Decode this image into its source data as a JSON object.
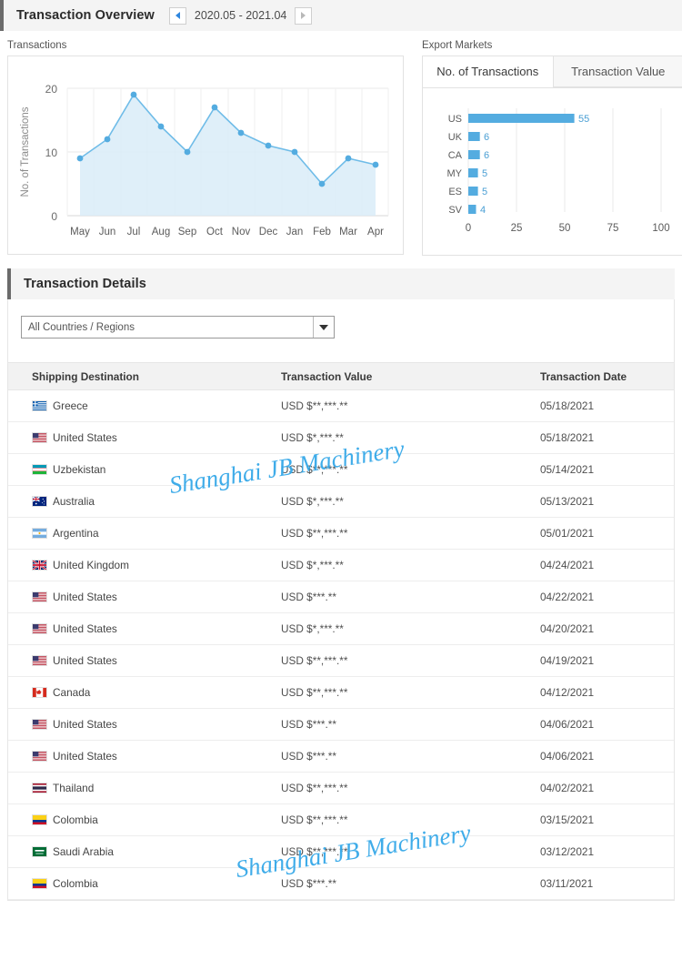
{
  "overview": {
    "title": "Transaction Overview",
    "date_range": "2020.05 - 2021.04",
    "prev_label": "◀",
    "next_label": "▶",
    "transactions_label": "Transactions",
    "export_markets_label": "Export Markets",
    "tabs": [
      {
        "label": "No. of Transactions",
        "active": true
      },
      {
        "label": "Transaction Value",
        "active": false
      }
    ]
  },
  "details": {
    "title": "Transaction Details",
    "filter_value": "All Countries / Regions",
    "columns": [
      "Shipping Destination",
      "Transaction Value",
      "Transaction Date"
    ],
    "rows": [
      {
        "country": "Greece",
        "flag": "gr",
        "value": "USD $**,***.**",
        "date": "05/18/2021"
      },
      {
        "country": "United States",
        "flag": "us",
        "value": "USD $*,***.**",
        "date": "05/18/2021"
      },
      {
        "country": "Uzbekistan",
        "flag": "uz",
        "value": "USD $**,***.**",
        "date": "05/14/2021"
      },
      {
        "country": "Australia",
        "flag": "au",
        "value": "USD $*,***.**",
        "date": "05/13/2021"
      },
      {
        "country": "Argentina",
        "flag": "ar",
        "value": "USD $**,***.**",
        "date": "05/01/2021"
      },
      {
        "country": "United Kingdom",
        "flag": "gb",
        "value": "USD $*,***.**",
        "date": "04/24/2021"
      },
      {
        "country": "United States",
        "flag": "us",
        "value": "USD $***.**",
        "date": "04/22/2021"
      },
      {
        "country": "United States",
        "flag": "us",
        "value": "USD $*,***.**",
        "date": "04/20/2021"
      },
      {
        "country": "United States",
        "flag": "us",
        "value": "USD $**,***.**",
        "date": "04/19/2021"
      },
      {
        "country": "Canada",
        "flag": "ca",
        "value": "USD $**,***.**",
        "date": "04/12/2021"
      },
      {
        "country": "United States",
        "flag": "us",
        "value": "USD $***.**",
        "date": "04/06/2021"
      },
      {
        "country": "United States",
        "flag": "us",
        "value": "USD $***.**",
        "date": "04/06/2021"
      },
      {
        "country": "Thailand",
        "flag": "th",
        "value": "USD $**,***.**",
        "date": "04/02/2021"
      },
      {
        "country": "Colombia",
        "flag": "co",
        "value": "USD $**,***.**",
        "date": "03/15/2021"
      },
      {
        "country": "Saudi Arabia",
        "flag": "sa",
        "value": "USD $**,***.**",
        "date": "03/12/2021"
      },
      {
        "country": "Colombia",
        "flag": "co",
        "value": "USD $***.**",
        "date": "03/11/2021"
      }
    ]
  },
  "watermarks": [
    "Shanghai JB Machinery",
    "Shanghai JB Machinery"
  ],
  "colors": {
    "accent": "#54ace0",
    "area_fill": "#d9ecf8",
    "watermark": "#35a8e8"
  },
  "chart_data": [
    {
      "type": "line",
      "title": "Transactions",
      "xlabel": "",
      "ylabel": "No. of Transactions",
      "categories": [
        "May",
        "Jun",
        "Jul",
        "Aug",
        "Sep",
        "Oct",
        "Nov",
        "Dec",
        "Jan",
        "Feb",
        "Mar",
        "Apr"
      ],
      "values": [
        9,
        12,
        19,
        14,
        10,
        17,
        13,
        11,
        10,
        5,
        9,
        8
      ],
      "ylim": [
        0,
        20
      ],
      "yticks": [
        0,
        10,
        20
      ],
      "grid": true,
      "legend": "none",
      "area": true
    },
    {
      "type": "bar",
      "title": "Export Markets",
      "orientation": "horizontal",
      "xlabel": "",
      "ylabel": "",
      "categories": [
        "US",
        "UK",
        "CA",
        "MY",
        "ES",
        "SV"
      ],
      "values": [
        55,
        6,
        6,
        5,
        5,
        4
      ],
      "data_labels": [
        "55",
        "6",
        "6",
        "5",
        "5",
        "4"
      ],
      "xlim": [
        0,
        100
      ],
      "xticks": [
        0,
        25,
        50,
        75,
        100
      ],
      "grid": true,
      "legend": "none"
    }
  ]
}
